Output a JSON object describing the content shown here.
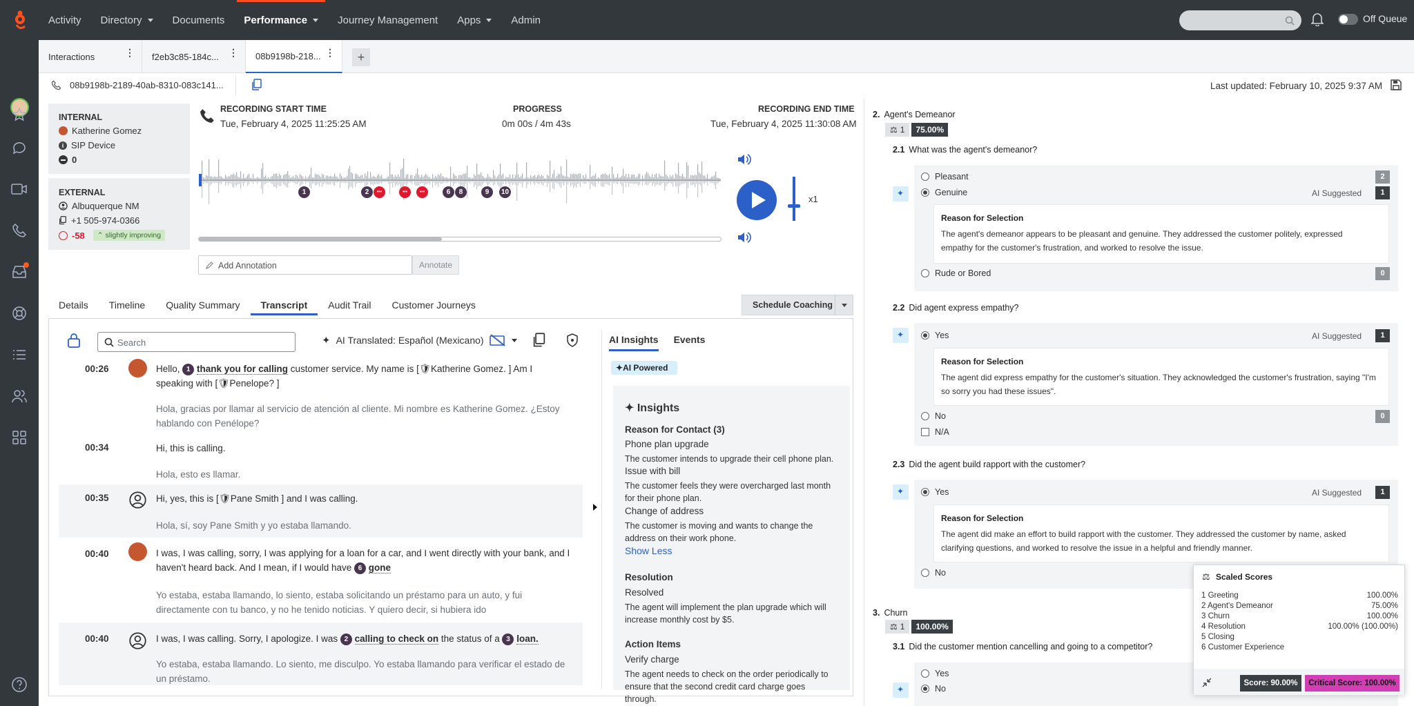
{
  "nav": {
    "items": [
      {
        "label": "Activity",
        "dropdown": false
      },
      {
        "label": "Directory",
        "dropdown": true
      },
      {
        "label": "Documents",
        "dropdown": false
      },
      {
        "label": "Performance",
        "dropdown": true,
        "active": true
      },
      {
        "label": "Journey Management",
        "dropdown": false
      },
      {
        "label": "Apps",
        "dropdown": true
      },
      {
        "label": "Admin",
        "dropdown": false
      }
    ],
    "status_label": "Off Queue"
  },
  "tabs": [
    {
      "label": "Interactions"
    },
    {
      "label": "f2eb3c85-184c..."
    },
    {
      "label": "08b9198b-218..."
    }
  ],
  "tab_add": "+",
  "subheader": {
    "interaction_id": "08b9198b-2189-40ab-8310-083c141...",
    "last_updated": "Last updated: February 10, 2025 9:37 AM"
  },
  "internal": {
    "label": "INTERNAL",
    "name": "Katherine Gomez",
    "device": "SIP Device",
    "count": "0"
  },
  "external": {
    "label": "EXTERNAL",
    "location": "Albuquerque NM",
    "phone": "+1 505-974-0366",
    "sentiment": "-58",
    "trend": "slightly improving"
  },
  "recording": {
    "start_label": "RECORDING START TIME",
    "start_value": "Tue, February 4, 2025 11:25:25 AM",
    "progress_label": "PROGRESS",
    "progress_value": "0m 00s / 4m 43s",
    "end_label": "RECORDING END TIME",
    "end_value": "Tue, February 4, 2025 11:30:08 AM",
    "speed": "x1",
    "markers": [
      "1",
      "2",
      "6",
      "8",
      "9",
      "10"
    ],
    "annotation_placeholder": "Add Annotation",
    "annotate_button": "Annotate",
    "progress_fraction": 0.465
  },
  "detail_tabs": [
    "Details",
    "Timeline",
    "Quality Summary",
    "Transcript",
    "Audit Trail",
    "Customer Journeys"
  ],
  "schedule_coaching": "Schedule Coaching",
  "transcript": {
    "search_placeholder": "Search",
    "translated_label": "AI Translated: Español (Mexicano)",
    "messages": [
      {
        "time": "00:26",
        "speaker": "agent",
        "pre": "Hello, ",
        "num": "1",
        "keyword": "thank you for calling",
        "post": " customer service. My name is [",
        "redact1": "Katherine Gomez.",
        "post2": " ] Am I speaking with [",
        "redact2": "Penelope?",
        "post3": " ]",
        "translation": "Hola, gracias por llamar al servicio de atención al cliente. Mi nombre es Katherine Gomez. ¿Estoy hablando con Penélope?"
      },
      {
        "time": "00:34",
        "speaker": "agent",
        "text": "Hi, this is calling.",
        "translation": "Hola, esto es llamar."
      },
      {
        "time": "00:35",
        "speaker": "customer",
        "pre": "Hi, yes, this is [",
        "redact1": "Pane Smith",
        "post": " ] and I was calling.",
        "translation": "Hola, sí, soy Pane Smith y yo estaba llamando."
      },
      {
        "time": "00:40",
        "speaker": "agent",
        "pre": "I was, I was calling, sorry, I was applying for a loan for a car, and I went directly with your bank, and I haven't heard back. And I mean, if I would have ",
        "num": "6",
        "keyword": "gone",
        "translation": "Yo estaba, estaba llamando, lo siento, estaba solicitando un préstamo para un auto, y fui directamente con tu banco, y no he tenido noticias. Y quiero decir, si hubiera ido"
      },
      {
        "time": "00:40",
        "speaker": "customer",
        "pre": "I was, I was calling. Sorry, I apologize. I was ",
        "num": "2",
        "keyword": "calling to check on",
        "mid": " the status of a ",
        "num2": "3",
        "keyword2": "loan.",
        "translation": "Yo estaba, estaba llamando. Lo siento, me disculpo. Yo estaba llamando para verificar el estado de un préstamo."
      }
    ]
  },
  "ai": {
    "tabs": [
      "AI Insights",
      "Events"
    ],
    "badge": "AI Powered",
    "title": "Insights",
    "reason_heading": "Reason for Contact (3)",
    "reasons": [
      {
        "title": "Phone plan upgrade",
        "desc": "The customer intends to upgrade their cell phone plan."
      },
      {
        "title": "Issue with bill",
        "desc": "The customer feels they were overcharged last month for their phone plan."
      },
      {
        "title": "Change of address",
        "desc": "The customer is moving and wants to change the address on their work phone."
      }
    ],
    "show_less": "Show Less",
    "resolution_heading": "Resolution",
    "resolution_value": "Resolved",
    "resolution_desc": "The agent will implement the plan upgrade which will increase monthly cost by $5.",
    "action_heading": "Action Items",
    "action_title": "Verify charge",
    "action_desc": "The agent needs to check on the order periodically to ensure that the second credit card charge goes through."
  },
  "evaluation": {
    "section2": {
      "num": "2.",
      "title": "Agent's Demeanor",
      "weight": "1",
      "score": "75.00%"
    },
    "q21": {
      "num": "2.1",
      "text": "What was the agent's demeanor?",
      "options": [
        {
          "label": "Pleasant",
          "count": "2",
          "selected": false
        },
        {
          "label": "Genuine",
          "count": "1",
          "selected": true
        },
        {
          "label": "Rude or Bored",
          "count": "0",
          "selected": false
        }
      ],
      "ai_suggested": "AI Suggested",
      "reason_title": "Reason for Selection",
      "reason": "The agent's demeanor appears to be pleasant and genuine. They addressed the customer politely, expressed empathy for the customer's frustration, and worked to resolve the issue."
    },
    "q22": {
      "num": "2.2",
      "text": "Did agent express empathy?",
      "yes": "Yes",
      "yes_count": "1",
      "no": "No",
      "no_count": "0",
      "na": "N/A",
      "ai_suggested": "AI Suggested",
      "reason_title": "Reason for Selection",
      "reason": "The agent did express empathy for the customer's situation. They acknowledged the customer's frustration, saying \"I'm so sorry you had these issues\"."
    },
    "q23": {
      "num": "2.3",
      "text": "Did the agent build rapport with the customer?",
      "yes": "Yes",
      "yes_count": "1",
      "no": "No",
      "ai_suggested": "AI Suggested",
      "reason_title": "Reason for Selection",
      "reason": "The agent did make an effort to build rapport with the customer. They addressed the customer by name, asked clarifying questions, and worked to resolve the issue in a helpful and friendly manner."
    },
    "section3": {
      "num": "3.",
      "title": "Churn",
      "weight": "1",
      "score": "100.00%"
    },
    "q31": {
      "num": "3.1",
      "text": "Did the customer mention cancelling and going to a competitor?",
      "yes": "Yes",
      "no": "No"
    }
  },
  "scaled_scores": {
    "title": "Scaled Scores",
    "rows": [
      {
        "name": "1 Greeting",
        "value": "100.00%"
      },
      {
        "name": "2 Agent's Demeanor",
        "value": "75.00%"
      },
      {
        "name": "3 Churn",
        "value": "100.00%"
      },
      {
        "name": "4 Resolution",
        "value": "100.00% (100.00%)"
      },
      {
        "name": "5 Closing",
        "value": ""
      },
      {
        "name": "6 Customer Experience",
        "value": ""
      }
    ],
    "score": "Score: 90.00%",
    "critical": "Critical Score: 100.00%"
  },
  "colors": {
    "accent": "#2a60c8",
    "brand": "#ff4f1f",
    "critical": "#d23fb5",
    "dark": "#33383d"
  }
}
